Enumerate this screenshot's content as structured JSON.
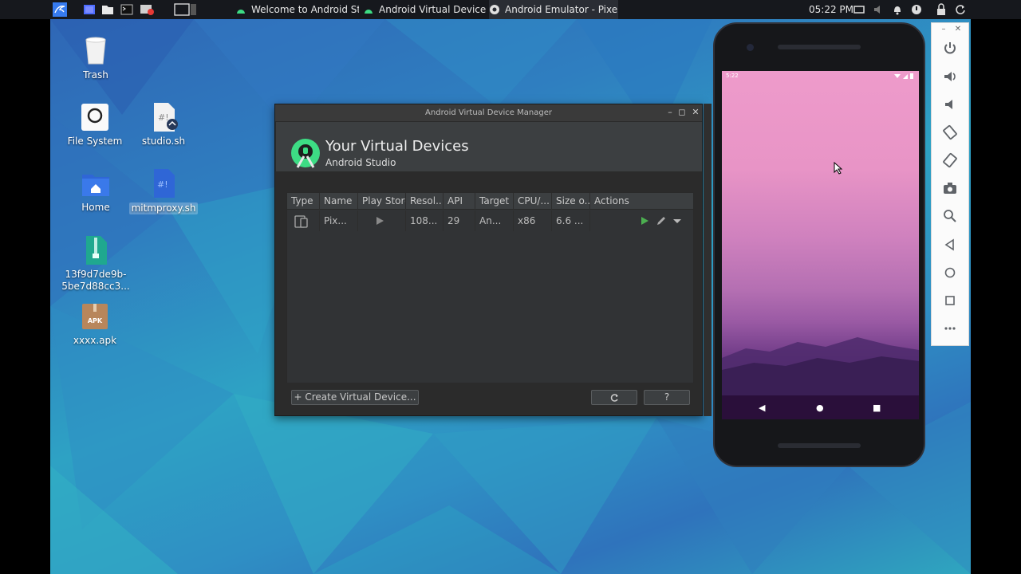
{
  "panel": {
    "tasks": [
      {
        "label": "Welcome to Android Stu..."
      },
      {
        "label": "Android Virtual Device ..."
      },
      {
        "label": "Android Emulator - Pixel..."
      }
    ],
    "clock": "05:22 PM"
  },
  "desktop": {
    "icons": [
      {
        "label": "Trash"
      },
      {
        "label": "File System"
      },
      {
        "label": "studio.sh"
      },
      {
        "label": "Home"
      },
      {
        "label": "mitmproxy.sh"
      },
      {
        "label_line1": "13f9d7de9b-",
        "label_line2": "5be7d88cc3..."
      },
      {
        "label": "xxxx.apk",
        "badge": "APK"
      }
    ]
  },
  "avd": {
    "window_title": "Android Virtual Device Manager",
    "heading": "Your Virtual Devices",
    "subheading": "Android Studio",
    "columns": [
      "Type",
      "Name",
      "Play Store",
      "Resol...",
      "API",
      "Target",
      "CPU/...",
      "Size o...",
      "Actions"
    ],
    "rows": [
      {
        "name": "Pix...",
        "resolution": "108...",
        "api": "29",
        "target": "An...",
        "cpu": "x86",
        "size": "6.6 ..."
      }
    ],
    "create_button": "Create Virtual Device...",
    "help_button": "?"
  },
  "phone": {
    "status_time": "5:22"
  },
  "colors": {
    "studio_green": "#3ddc84",
    "play_green": "#4caf50",
    "wallpaper_pink": "#ee9bcb",
    "panel_bg": "#16181d"
  }
}
